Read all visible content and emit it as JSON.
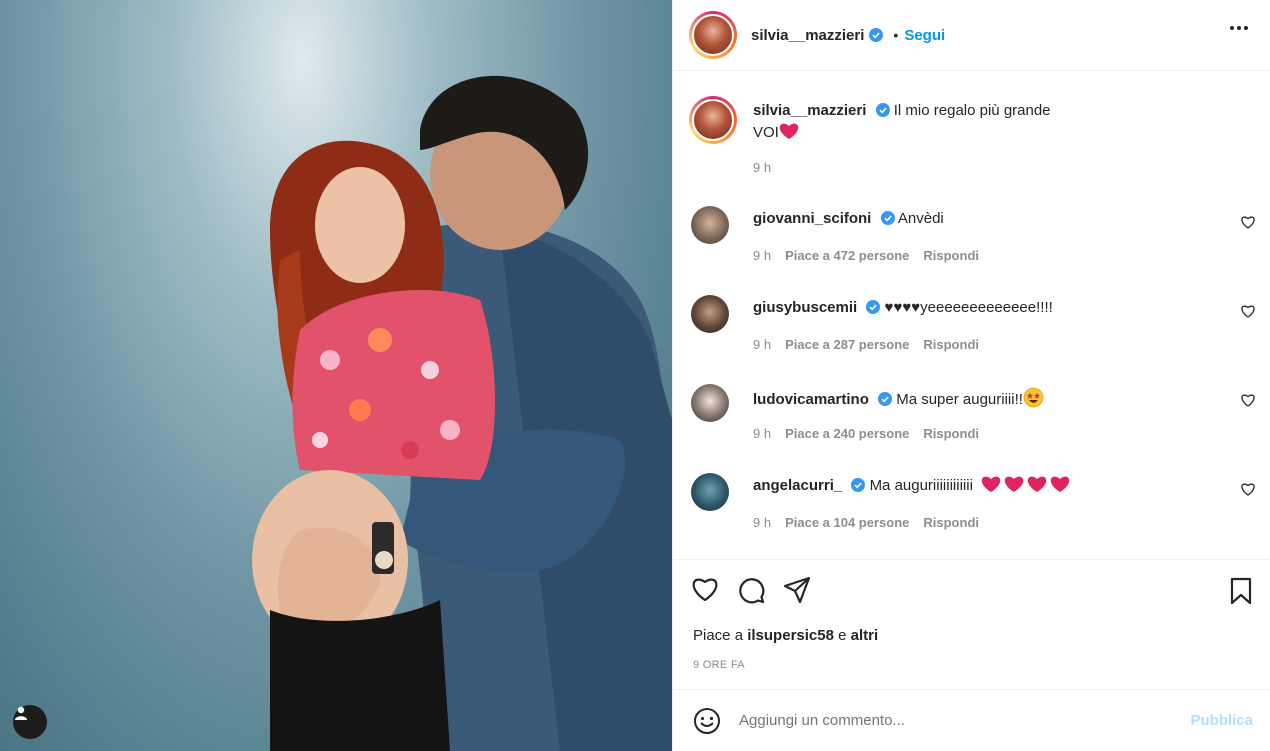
{
  "post": {
    "author": "silvia__mazzieri",
    "follow_label": "Segui",
    "dot": "•",
    "caption_author": "silvia__mazzieri",
    "caption_line1": "Il mio regalo più grande",
    "caption_line2": "VOI",
    "caption_time": "9 h"
  },
  "comments": [
    {
      "user": "giovanni_scifoni",
      "text": "Anvèdi",
      "time": "9 h",
      "likes": "Piace a 472 persone",
      "reply": "Rispondi"
    },
    {
      "user": "giusybuscemii",
      "text": "♥♥♥♥yeeeeeeeeeeeee!!!!",
      "time": "9 h",
      "likes": "Piace a 287 persone",
      "reply": "Rispondi"
    },
    {
      "user": "ludovicamartino",
      "text": "Ma super auguriiii!!",
      "time": "9 h",
      "likes": "Piace a 240 persone",
      "reply": "Rispondi"
    },
    {
      "user": "angelacurri_",
      "text": "Ma auguriiiiiiiiiiii",
      "time": "9 h",
      "likes": "Piace a 104 persone",
      "reply": "Rispondi"
    }
  ],
  "likes": {
    "prefix": "Piace a",
    "user": "ilsupersic58",
    "mid": "e",
    "others": "altri"
  },
  "timestamp": "9 ORE FA",
  "add_comment": {
    "placeholder": "Aggiungi un commento...",
    "publish_label": "Pubblica"
  },
  "colors": {
    "accent": "#0095f6",
    "verified": "#3897f0",
    "heart": "#e0245e",
    "publish_disabled": "#b2dffc"
  }
}
